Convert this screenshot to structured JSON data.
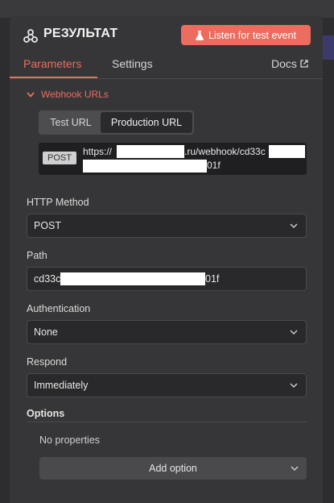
{
  "node": {
    "title": "РЕЗУЛЬТАТ",
    "icon": "webhook-icon"
  },
  "header": {
    "listen_label": "Listen for test event",
    "accent": "#ec6d5f"
  },
  "tabs": [
    {
      "label": "Parameters",
      "active": true
    },
    {
      "label": "Settings",
      "active": false
    },
    {
      "label": "Docs",
      "active": false
    }
  ],
  "webhook": {
    "section_label": "Webhook URLs",
    "test_label": "Test URL",
    "production_label": "Production URL",
    "method": "POST",
    "url_prefix": "https://",
    "url_mid": ".ru/webhook/cd33c",
    "url_end": "01f"
  },
  "fields": {
    "http_method": {
      "label": "HTTP Method",
      "value": "POST"
    },
    "path": {
      "label": "Path",
      "value_start": "cd33c",
      "value_end": "01f"
    },
    "authentication": {
      "label": "Authentication",
      "value": "None"
    },
    "respond": {
      "label": "Respond",
      "value": "Immediately"
    }
  },
  "options": {
    "label": "Options",
    "empty_text": "No properties",
    "add_label": "Add option"
  }
}
